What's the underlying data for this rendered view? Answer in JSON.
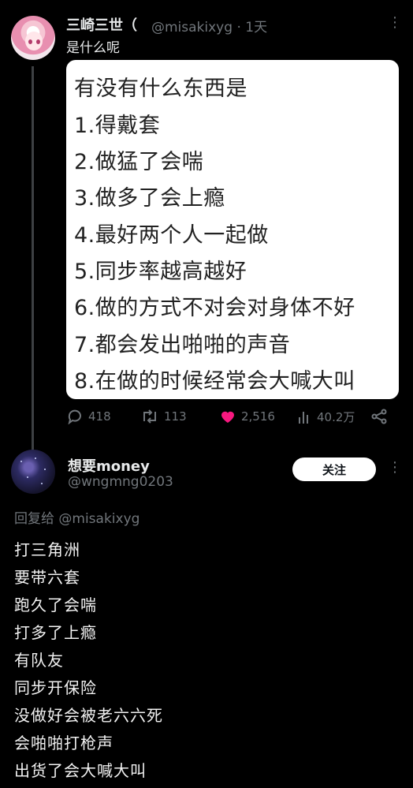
{
  "post": {
    "author_name": "三崎三世（",
    "author_handle_time": "@misakixyg · 1天",
    "text": "是什么呢",
    "image_lines": [
      "有没有什么东西是",
      "1.得戴套",
      "2.做猛了会喘",
      "3.做多了会上瘾",
      "4.最好两个人一起做",
      "5.同步率越高越好",
      "6.做的方式不对会对身体不好",
      "7.都会发出啪啪的声音",
      "8.在做的时候经常会大喊大叫"
    ],
    "stats": {
      "replies": "418",
      "reposts": "113",
      "likes": "2,516",
      "views": "40.2万"
    },
    "like_color": "#f91880"
  },
  "reply": {
    "author_name": "想要money",
    "author_handle": "@wngmng0203",
    "follow_label": "关注",
    "replying_to": "回复给 @misakixyg",
    "lines": [
      "打三角洲",
      "要带六套",
      "跑久了会喘",
      "打多了上瘾",
      "有队友",
      "同步开保险",
      "没做好会被老六六死",
      "会啪啪打枪声",
      "出货了会大喊大叫"
    ]
  }
}
